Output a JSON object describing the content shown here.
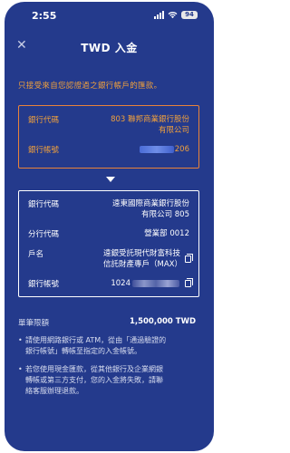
{
  "status_bar": {
    "time": "2:55",
    "battery": "94"
  },
  "nav": {
    "title": "TWD 入金"
  },
  "notice": "只接受來自您認證過之銀行帳戶的匯款。",
  "source_account": {
    "bank_code_label": "銀行代碼",
    "bank_code_value_line1": "803 聯邦商業銀行股份",
    "bank_code_value_line2": "有限公司",
    "account_label": "銀行帳號",
    "account_suffix": "206"
  },
  "destination_account": {
    "bank_code_label": "銀行代碼",
    "bank_code_value_line1": "遠東國際商業銀行股份",
    "bank_code_value_line2": "有限公司 805",
    "branch_label": "分行代碼",
    "branch_value": "營業部 0012",
    "name_label": "戶名",
    "name_value_line1": "遠銀受託現代財富科技",
    "name_value_line2": "信託財產專戶（MAX）",
    "account_label": "銀行帳號",
    "account_prefix": "1024"
  },
  "limit": {
    "label": "單筆限額",
    "value": "1,500,000 TWD"
  },
  "bullets": [
    {
      "line1": "請使用網路銀行或 ATM，從由「通過驗證的",
      "line2": "銀行帳號」轉帳至指定的入金帳號。"
    },
    {
      "line1": "若您使用現金匯款，從其他銀行及企業網銀",
      "line2": "轉帳或第三方支付，您的入金將失敗，請聯",
      "line3": "絡客服辦理退款。"
    }
  ]
}
